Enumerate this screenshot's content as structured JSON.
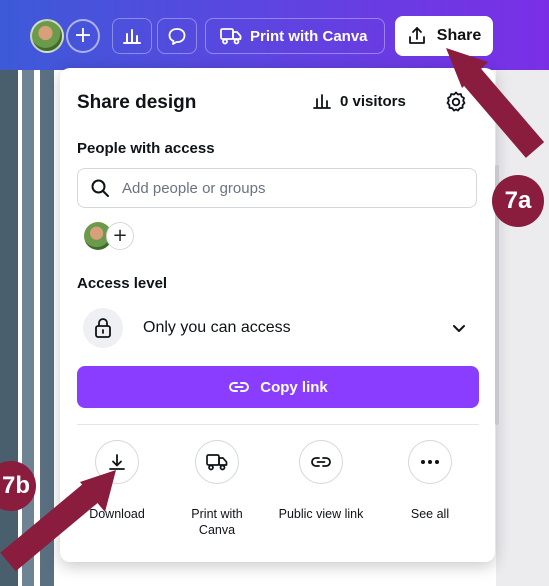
{
  "toolbar": {
    "plus_glyph": "+",
    "print_label": "Print with Canva",
    "share_label": "Share"
  },
  "panel": {
    "title": "Share design",
    "visitors": "0 visitors",
    "people_heading": "People with access",
    "search_placeholder": "Add people or groups",
    "add_glyph": "+",
    "access_heading": "Access level",
    "access_value": "Only you can access",
    "copy_label": "Copy link",
    "actions": [
      {
        "label": "Download"
      },
      {
        "label": "Print with\nCanva"
      },
      {
        "label": "Public view link"
      },
      {
        "label": "See all"
      }
    ]
  },
  "callouts": {
    "a": "7a",
    "b": "7b"
  },
  "colors": {
    "accent": "#8b3dff",
    "callout": "#8a1c3d"
  }
}
